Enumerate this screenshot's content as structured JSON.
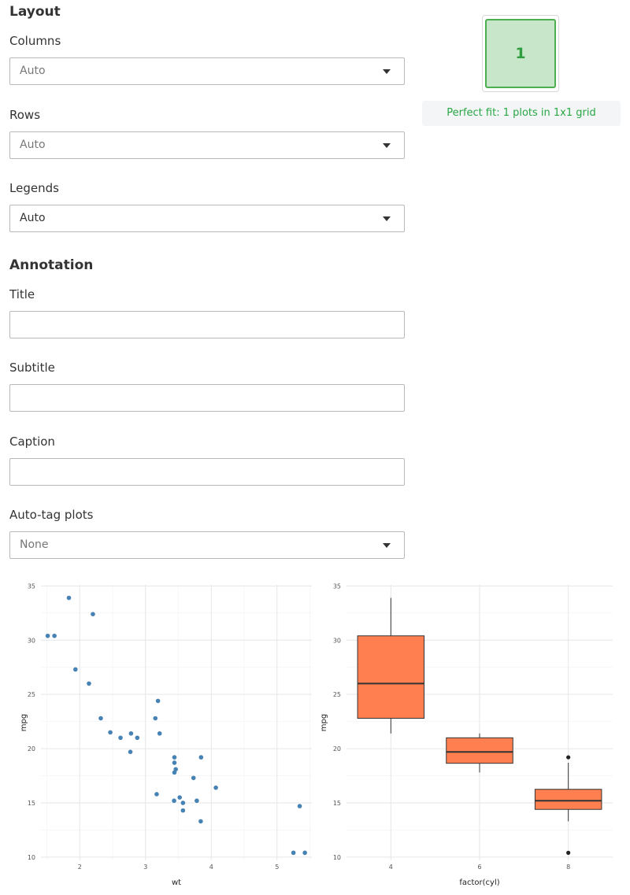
{
  "layout": {
    "heading": "Layout",
    "columns": {
      "label": "Columns",
      "value": "Auto"
    },
    "rows": {
      "label": "Rows",
      "value": "Auto"
    },
    "legends": {
      "label": "Legends",
      "value": "Auto"
    }
  },
  "annotation": {
    "heading": "Annotation",
    "title": {
      "label": "Title",
      "value": ""
    },
    "subtitle": {
      "label": "Subtitle",
      "value": ""
    },
    "caption": {
      "label": "Caption",
      "value": ""
    },
    "autotag": {
      "label": "Auto-tag plots",
      "value": "None"
    }
  },
  "preview": {
    "cell_label": "1",
    "fit_message": "Perfect fit: 1 plots in 1x1 grid",
    "colors": {
      "cell_fill": "#c8e6c9",
      "cell_border": "#4caf50",
      "message": "#28a745"
    }
  },
  "chart_data": [
    {
      "type": "scatter",
      "xlabel": "wt",
      "ylabel": "mpg",
      "xticks": [
        2,
        3,
        4,
        5
      ],
      "yticks": [
        10,
        15,
        20,
        25,
        30,
        35
      ],
      "xlim": [
        1.41,
        5.53
      ],
      "ylim": [
        9.7,
        35.1
      ],
      "color": "#4682b4",
      "grid": true,
      "points": [
        {
          "x": 2.62,
          "y": 21.0
        },
        {
          "x": 2.875,
          "y": 21.0
        },
        {
          "x": 2.32,
          "y": 22.8
        },
        {
          "x": 3.215,
          "y": 21.4
        },
        {
          "x": 3.44,
          "y": 18.7
        },
        {
          "x": 3.46,
          "y": 18.1
        },
        {
          "x": 3.57,
          "y": 14.3
        },
        {
          "x": 3.19,
          "y": 24.4
        },
        {
          "x": 3.15,
          "y": 22.8
        },
        {
          "x": 3.44,
          "y": 19.2
        },
        {
          "x": 3.44,
          "y": 17.8
        },
        {
          "x": 4.07,
          "y": 16.4
        },
        {
          "x": 3.73,
          "y": 17.3
        },
        {
          "x": 3.78,
          "y": 15.2
        },
        {
          "x": 5.25,
          "y": 10.4
        },
        {
          "x": 5.424,
          "y": 10.4
        },
        {
          "x": 5.345,
          "y": 14.7
        },
        {
          "x": 2.2,
          "y": 32.4
        },
        {
          "x": 1.615,
          "y": 30.4
        },
        {
          "x": 1.835,
          "y": 33.9
        },
        {
          "x": 2.465,
          "y": 21.5
        },
        {
          "x": 3.52,
          "y": 15.5
        },
        {
          "x": 3.435,
          "y": 15.2
        },
        {
          "x": 3.84,
          "y": 13.3
        },
        {
          "x": 3.845,
          "y": 19.2
        },
        {
          "x": 1.935,
          "y": 27.3
        },
        {
          "x": 2.14,
          "y": 26.0
        },
        {
          "x": 1.513,
          "y": 30.4
        },
        {
          "x": 3.17,
          "y": 15.8
        },
        {
          "x": 2.77,
          "y": 19.7
        },
        {
          "x": 3.57,
          "y": 15.0
        },
        {
          "x": 2.78,
          "y": 21.4
        }
      ]
    },
    {
      "type": "box",
      "xlabel": "factor(cyl)",
      "ylabel": "mpg",
      "categories": [
        "4",
        "6",
        "8"
      ],
      "yticks": [
        10,
        15,
        20,
        25,
        30,
        35
      ],
      "ylim": [
        9.7,
        35.1
      ],
      "color": "#ff7f50",
      "grid": true,
      "boxes": [
        {
          "category": "4",
          "min": 21.4,
          "q1": 22.8,
          "median": 26.0,
          "q3": 30.4,
          "max": 33.9,
          "outliers": []
        },
        {
          "category": "6",
          "min": 17.8,
          "q1": 18.65,
          "median": 19.7,
          "q3": 21.0,
          "max": 21.4,
          "outliers": []
        },
        {
          "category": "8",
          "min": 13.3,
          "q1": 14.4,
          "median": 15.2,
          "q3": 16.25,
          "max": 18.7,
          "outliers": [
            10.4,
            19.2
          ]
        }
      ]
    }
  ]
}
